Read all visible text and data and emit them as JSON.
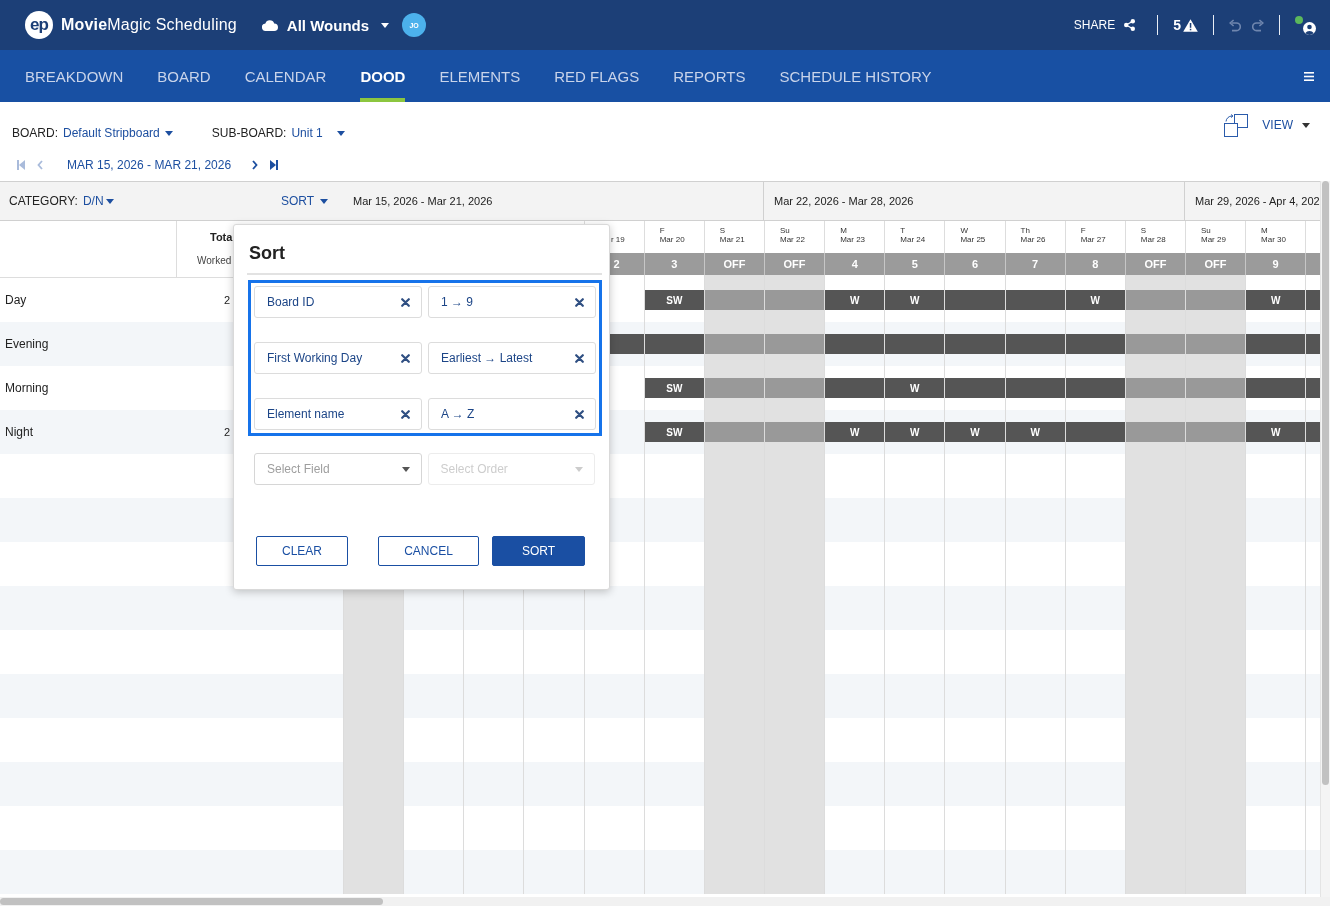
{
  "app_bar": {
    "logo": "ep",
    "app_name": "**Movie**Magic Scheduling",
    "project": "All Wounds",
    "user_initials": "JO",
    "share": "SHARE",
    "alert_count": "5",
    "undo": {
      "disabled": true
    },
    "redo": {
      "disabled": true
    },
    "online": true
  },
  "tabs": [
    {
      "label": "BREAKDOWN",
      "selected": false
    },
    {
      "label": "BOARD",
      "selected": false
    },
    {
      "label": "CALENDAR",
      "selected": false
    },
    {
      "label": "DOOD",
      "selected": true
    },
    {
      "label": "ELEMENTS",
      "selected": false
    },
    {
      "label": "RED FLAGS",
      "selected": false
    },
    {
      "label": "REPORTS",
      "selected": false
    },
    {
      "label": "SCHEDULE HISTORY",
      "selected": false
    }
  ],
  "toolbar": {
    "board": {
      "label": "BOARD:",
      "value": "Default Stripboard"
    },
    "sub_board": {
      "label": "SUB-BOARD:",
      "value": "Unit 1"
    },
    "view": "VIEW",
    "date_nav": [
      {
        "kind": "first",
        "disabled": true
      },
      {
        "kind": "previous",
        "disabled": true
      },
      {
        "kind": "next",
        "disabled": false
      },
      {
        "kind": "last",
        "disabled": false
      }
    ],
    "date_range": "MAR 15, 2026 - MAR 21, 2026"
  },
  "grid": {
    "category": {
      "label": "CATEGORY:",
      "value": "D/N"
    },
    "sort": "SORT",
    "weeks": [
      "Mar 15, 2026 - Mar 21, 2026",
      "Mar 22, 2026 - Mar 28, 2026",
      "Mar 29, 2026 - Apr 4, 202"
    ],
    "total_heading": "Tota",
    "worked_heading": "Worked",
    "days": [
      {
        "kind": "covered",
        "weekend": true
      },
      {
        "kind": "covered",
        "weekend": false
      },
      {
        "kind": "covered",
        "weekend": false
      },
      {
        "kind": "covered",
        "weekend": false
      },
      {
        "kind": "clipped",
        "date": "r 19",
        "number": "2",
        "weekend": false
      },
      {
        "kind": "full",
        "day": "F",
        "date": "Mar 20",
        "number": "3",
        "weekend": false
      },
      {
        "kind": "full",
        "day": "S",
        "date": "Mar 21",
        "number": "OFF",
        "weekend": true
      },
      {
        "kind": "full",
        "day": "Su",
        "date": "Mar 22",
        "number": "OFF",
        "weekend": true
      },
      {
        "kind": "full",
        "day": "M",
        "date": "Mar 23",
        "number": "4",
        "weekend": false
      },
      {
        "kind": "full",
        "day": "T",
        "date": "Mar 24",
        "number": "5",
        "weekend": false
      },
      {
        "kind": "full",
        "day": "W",
        "date": "Mar 25",
        "number": "6",
        "weekend": false
      },
      {
        "kind": "full",
        "day": "Th",
        "date": "Mar 26",
        "number": "7",
        "weekend": false
      },
      {
        "kind": "full",
        "day": "F",
        "date": "Mar 27",
        "number": "8",
        "weekend": false
      },
      {
        "kind": "full",
        "day": "S",
        "date": "Mar 28",
        "number": "OFF",
        "weekend": true
      },
      {
        "kind": "full",
        "day": "Su",
        "date": "Mar 29",
        "number": "OFF",
        "weekend": true
      },
      {
        "kind": "full",
        "day": "M",
        "date": "Mar 30",
        "number": "9",
        "weekend": false
      },
      {
        "kind": "full",
        "weekend": false
      }
    ],
    "rows": [
      {
        "name": "Day",
        "total": "2",
        "cells": [
          {
            "kind": "blank"
          },
          {
            "kind": "blank"
          },
          {
            "kind": "blank"
          },
          {
            "kind": "blank"
          },
          {
            "kind": "blank"
          },
          {
            "kind": "work",
            "label": "SW"
          },
          {
            "kind": "off"
          },
          {
            "kind": "off"
          },
          {
            "kind": "work",
            "label": "W"
          },
          {
            "kind": "work",
            "label": "W"
          },
          {
            "kind": "work"
          },
          {
            "kind": "work"
          },
          {
            "kind": "work",
            "label": "W"
          },
          {
            "kind": "off"
          },
          {
            "kind": "off"
          },
          {
            "kind": "work",
            "label": "W"
          },
          {
            "kind": "work"
          }
        ]
      },
      {
        "name": "Evening",
        "cells": [
          {
            "kind": "blank"
          },
          {
            "kind": "blank"
          },
          {
            "kind": "blank"
          },
          {
            "kind": "blank"
          },
          {
            "kind": "work"
          },
          {
            "kind": "work"
          },
          {
            "kind": "off"
          },
          {
            "kind": "off"
          },
          {
            "kind": "work"
          },
          {
            "kind": "work"
          },
          {
            "kind": "work"
          },
          {
            "kind": "work"
          },
          {
            "kind": "work"
          },
          {
            "kind": "off"
          },
          {
            "kind": "off"
          },
          {
            "kind": "work"
          },
          {
            "kind": "work"
          }
        ]
      },
      {
        "name": "Morning",
        "cells": [
          {
            "kind": "blank"
          },
          {
            "kind": "blank"
          },
          {
            "kind": "blank"
          },
          {
            "kind": "blank"
          },
          {
            "kind": "blank"
          },
          {
            "kind": "work",
            "label": "SW"
          },
          {
            "kind": "off"
          },
          {
            "kind": "off"
          },
          {
            "kind": "work"
          },
          {
            "kind": "work",
            "label": "W"
          },
          {
            "kind": "work"
          },
          {
            "kind": "work"
          },
          {
            "kind": "work"
          },
          {
            "kind": "off"
          },
          {
            "kind": "off"
          },
          {
            "kind": "work"
          },
          {
            "kind": "work"
          }
        ]
      },
      {
        "name": "Night",
        "total": "2",
        "cells": [
          {
            "kind": "blank"
          },
          {
            "kind": "blank"
          },
          {
            "kind": "blank"
          },
          {
            "kind": "blank"
          },
          {
            "kind": "blank"
          },
          {
            "kind": "work",
            "label": "SW"
          },
          {
            "kind": "off"
          },
          {
            "kind": "off"
          },
          {
            "kind": "work",
            "label": "W"
          },
          {
            "kind": "work",
            "label": "W"
          },
          {
            "kind": "work",
            "label": "W"
          },
          {
            "kind": "work",
            "label": "W"
          },
          {
            "kind": "work"
          },
          {
            "kind": "off"
          },
          {
            "kind": "off"
          },
          {
            "kind": "work",
            "label": "W"
          },
          {
            "kind": "work"
          }
        ]
      }
    ]
  },
  "sort_dialog": {
    "title": "Sort",
    "rules": [
      {
        "field": "Board ID",
        "order": "1 → 9"
      },
      {
        "field": "First Working Day",
        "order": "Earliest → Latest"
      },
      {
        "field": "Element name",
        "order": "A → Z"
      }
    ],
    "field_select": {
      "placeholder": "Select Field",
      "disabled": false
    },
    "order_select": {
      "placeholder": "Select Order",
      "disabled": true
    },
    "buttons": [
      {
        "kind": "clear",
        "label": "CLEAR"
      },
      {
        "kind": "cancel",
        "label": "CANCEL"
      },
      {
        "kind": "apply",
        "label": "SORT"
      }
    ]
  }
}
